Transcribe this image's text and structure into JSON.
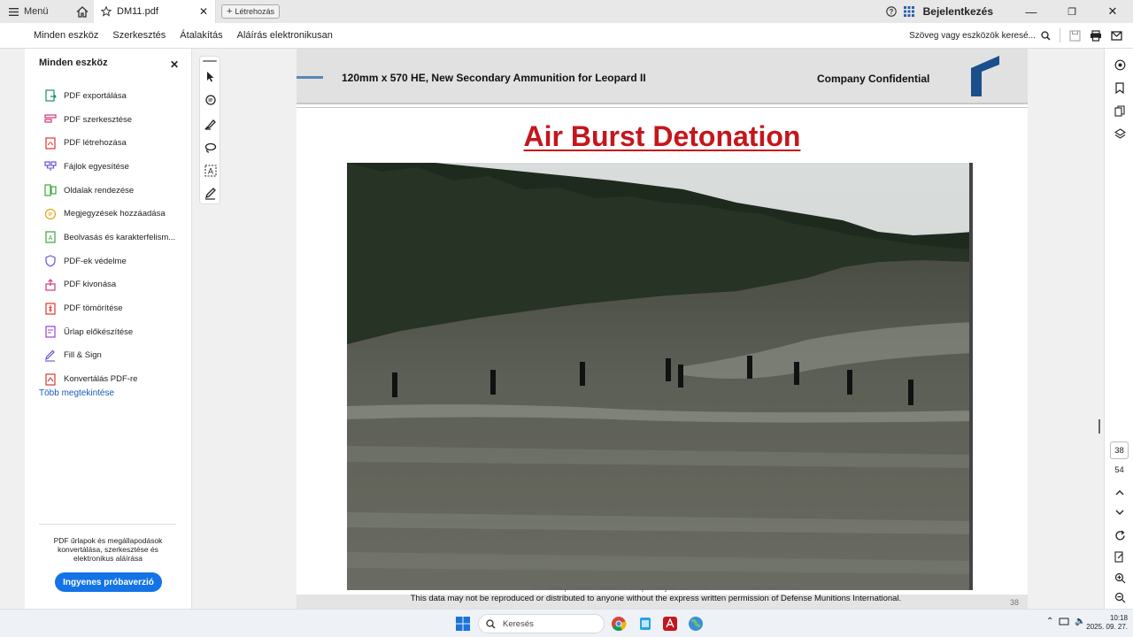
{
  "titlebar": {
    "menu_label": "Menü",
    "tab_title": "DM11.pdf",
    "new_tab_label": "Létrehozás",
    "signin_label": "Bejelentkezés"
  },
  "menubar": {
    "items": [
      "Minden eszköz",
      "Szerkesztés",
      "Átalakítás",
      "Aláírás elektronikusan"
    ],
    "search_placeholder": "Szöveg vagy eszközök keresé..."
  },
  "left_panel": {
    "title": "Minden eszköz",
    "tools": [
      {
        "label": "PDF exportálása",
        "icon": "export-pdf-icon",
        "color": "#1f8e6e"
      },
      {
        "label": "PDF szerkesztése",
        "icon": "edit-pdf-icon",
        "color": "#d3347b"
      },
      {
        "label": "PDF létrehozása",
        "icon": "create-pdf-icon",
        "color": "#e0362c"
      },
      {
        "label": "Fájlok egyesítése",
        "icon": "combine-files-icon",
        "color": "#6b4fd8"
      },
      {
        "label": "Oldalak rendezése",
        "icon": "organize-pages-icon",
        "color": "#3aa63a"
      },
      {
        "label": "Megjegyzések hozzáadása",
        "icon": "comment-icon",
        "color": "#e8a317"
      },
      {
        "label": "Beolvasás és karakterfelism...",
        "icon": "scan-ocr-icon",
        "color": "#3aa63a"
      },
      {
        "label": "PDF-ek védelme",
        "icon": "protect-pdf-icon",
        "color": "#6b4fd8"
      },
      {
        "label": "PDF kivonása",
        "icon": "extract-pdf-icon",
        "color": "#d3347b"
      },
      {
        "label": "PDF tömörítése",
        "icon": "compress-pdf-icon",
        "color": "#e0362c"
      },
      {
        "label": "Űrlap előkészítése",
        "icon": "prepare-form-icon",
        "color": "#9b3fc8"
      },
      {
        "label": "Fill & Sign",
        "icon": "fill-sign-icon",
        "color": "#6b4fd8"
      },
      {
        "label": "Konvertálás PDF-re",
        "icon": "convert-pdf-icon",
        "color": "#e0362c"
      }
    ],
    "more_link": "Több megtekintése",
    "promo_text": "PDF űrlapok és megállapodások konvertálása, szerkesztése és elektronikus aláírása",
    "trial_button": "Ingyenes próbaverzió"
  },
  "document": {
    "header_title": "120mm x 570 HE, New Secondary Ammunition for Leopard II",
    "header_confidential": "Company Confidential",
    "slide_title": "Air Burst Detonation",
    "footer_line1": "The data provided herein is Proprietary to Defense Munitions International.",
    "footer_line2": "This data may not be reproduced or distributed to anyone without the express written permission of Defense Munitions International.",
    "page_number": "38"
  },
  "right_rail": {
    "current_page": "38",
    "total_pages": "54"
  },
  "taskbar": {
    "search_placeholder": "Keresés",
    "time": "10:18",
    "date": "2025. 09. 27."
  },
  "colors": {
    "accent": "#1473e6",
    "slide_title": "#c4161c",
    "link": "#1a5bb8"
  }
}
